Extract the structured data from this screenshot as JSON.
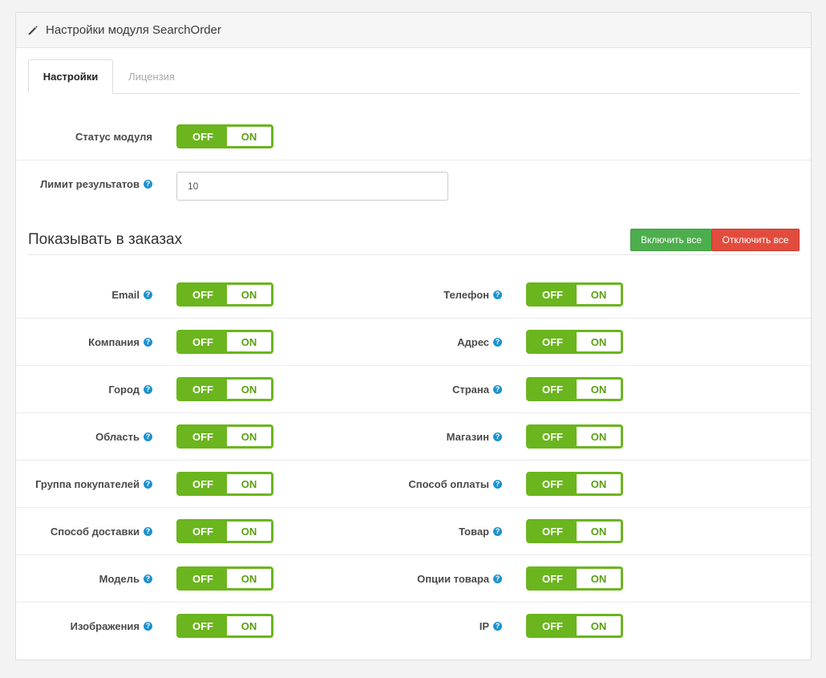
{
  "panel": {
    "title": "Настройки модуля SearchOrder",
    "icon": "pencil-icon"
  },
  "tabs": [
    {
      "label": "Настройки",
      "active": true
    },
    {
      "label": "Лицензия",
      "active": false
    }
  ],
  "settings": {
    "status_label": "Статус модуля",
    "limit_label": "Лимит результатов",
    "limit_value": "10"
  },
  "toggle": {
    "off_label": "OFF",
    "on_label": "ON"
  },
  "help_glyph": "?",
  "section": {
    "title": "Показывать в заказах",
    "enable_all": "Включить все",
    "disable_all": "Отключить все"
  },
  "fields_left": [
    {
      "label": "Email"
    },
    {
      "label": "Компания"
    },
    {
      "label": "Город"
    },
    {
      "label": "Область"
    },
    {
      "label": "Группа покупателей"
    },
    {
      "label": "Способ доставки"
    },
    {
      "label": "Модель"
    },
    {
      "label": "Изображения"
    }
  ],
  "fields_right": [
    {
      "label": "Телефон"
    },
    {
      "label": "Адрес"
    },
    {
      "label": "Страна"
    },
    {
      "label": "Магазин"
    },
    {
      "label": "Способ оплаты"
    },
    {
      "label": "Товар"
    },
    {
      "label": "Опции товара"
    },
    {
      "label": "IP"
    }
  ],
  "colors": {
    "toggle_green": "#6bb51e",
    "help_blue": "#1e91cf",
    "enable_green": "#4cae4c",
    "disable_red": "#e24c3e"
  }
}
